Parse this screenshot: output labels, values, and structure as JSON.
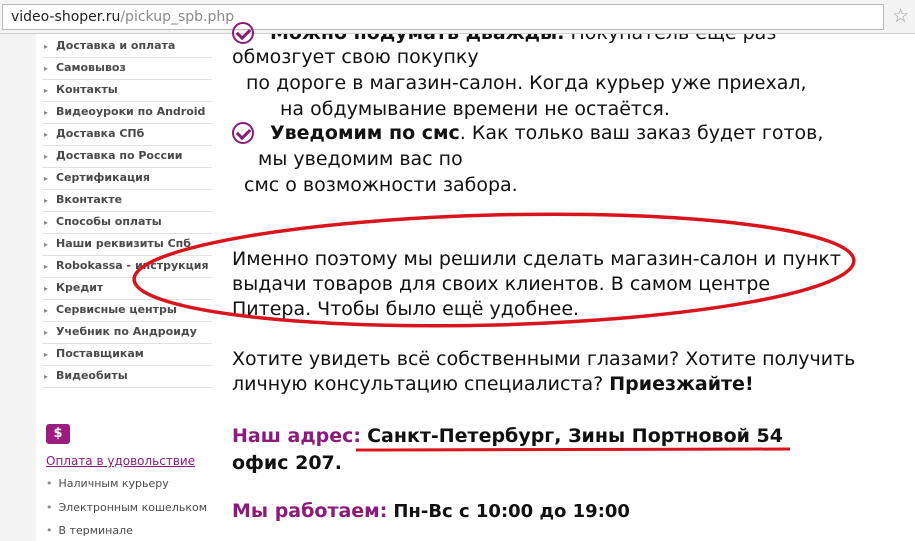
{
  "browser": {
    "url_host": "video-shoper.ru",
    "url_path": "/pickup_spb.php",
    "star_icon": "star-icon"
  },
  "sidebar": {
    "items": [
      {
        "label": "Доставка и оплата"
      },
      {
        "label": "Самовывоз"
      },
      {
        "label": "Контакты"
      },
      {
        "label": "Видеоуроки по Android"
      },
      {
        "label": "Доставка СПб"
      },
      {
        "label": "Доставка по России"
      },
      {
        "label": "Сертификация"
      },
      {
        "label": "Вконтакте"
      },
      {
        "label": "Способы оплаты"
      },
      {
        "label": "Наши реквизиты Спб"
      },
      {
        "label": "Robokassa - инструкция"
      },
      {
        "label": "Кредит"
      },
      {
        "label": "Сервисные центры"
      },
      {
        "label": "Учебник по Андроиду"
      },
      {
        "label": "Поставщикам"
      },
      {
        "label": "Видеобиты"
      }
    ],
    "payment": {
      "icon_text": "$",
      "title": "Оплата в удовольствие",
      "items": [
        "Наличным курьеру",
        "Электронным кошельком",
        "В терминале"
      ]
    }
  },
  "content": {
    "top_line_bold": "Можно подумать дважды.",
    "top_line_rest": " Покупатель еще раз",
    "line1": "обмозгует свою покупку",
    "line2": "по дороге в магазин-салон. Когда курьер уже приехал,",
    "line3": "на обдумывание времени не остаётся.",
    "sms_bold": "Уведомим по смс",
    "sms_rest": ". Как только ваш заказ будет готов,",
    "sms_line2": "мы уведомим вас по",
    "sms_line3": "смс о возможности забора.",
    "para1_line1": "Именно поэтому мы решили сделать магазин-салон и пункт",
    "para1_line2": "выдачи товаров для своих клиентов. В самом центре",
    "para1_line3": "Питера. Чтобы было ещё удобнее.",
    "para2_line1": "Хотите увидеть всё собственными глазами? Хотите получить",
    "para2_line2_a": "личную консультацию специалиста? ",
    "para2_line2_b": "Приезжайте!",
    "address_label": "Наш адрес:",
    "address_value": "Санкт-Петербург, Зины Портновой 54",
    "address_office": "офис 207.",
    "hours_label": "Мы работаем:",
    "hours_value": "Пн-Вс с 10:00 до 19:00"
  },
  "colors": {
    "accent": "#8b1a7c",
    "annotation": "#d9141c"
  }
}
